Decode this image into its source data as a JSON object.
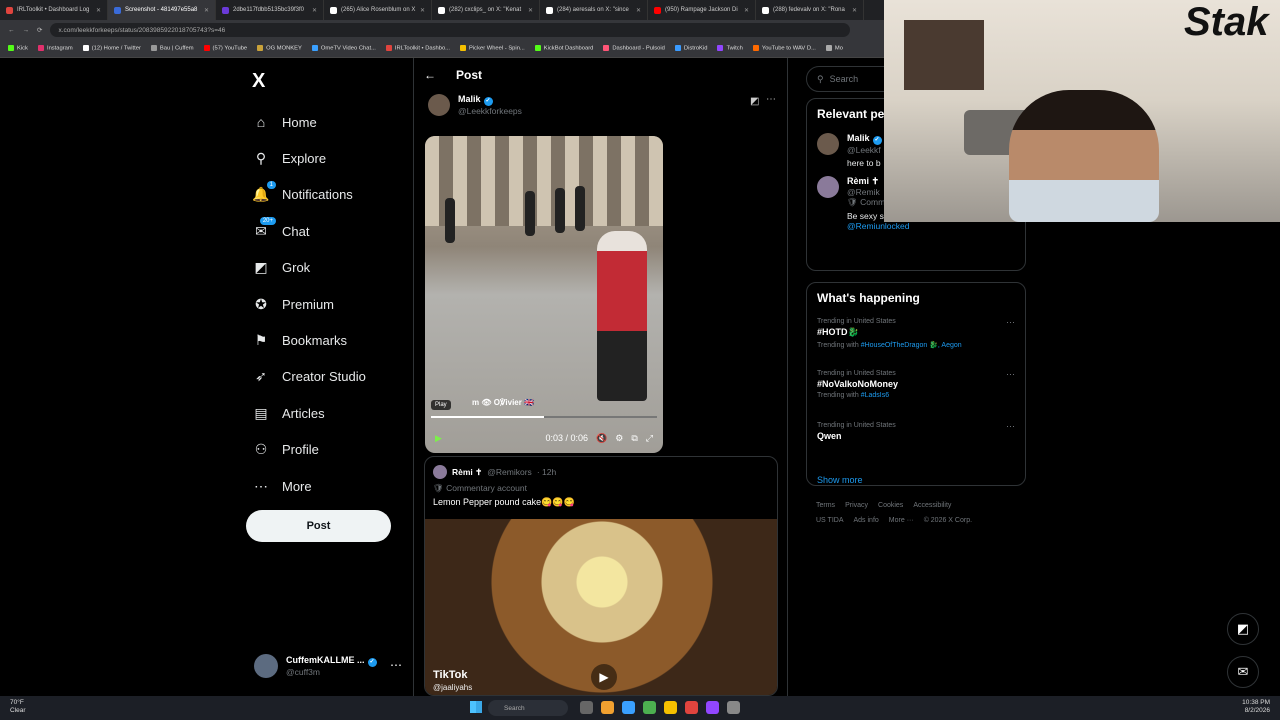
{
  "browser": {
    "tabs": [
      {
        "label": "IRLToolkit • Dashboard Log",
        "color": "#e0443e",
        "active": false
      },
      {
        "label": "Screenshot - 481497e55a8",
        "color": "#3a6bd9",
        "active": true
      },
      {
        "label": "2dbe117fdbb5135bc39f3f0",
        "color": "#6a3ad9",
        "active": false
      },
      {
        "label": "(265) Alice Rosenblum on X",
        "color": "#ffffff",
        "active": false
      },
      {
        "label": "(282) cxclips_ on X: \"Kenat",
        "color": "#ffffff",
        "active": false
      },
      {
        "label": "(284) aeresals on X: \"since",
        "color": "#ffffff",
        "active": false
      },
      {
        "label": "(950) Rampage Jackson Di",
        "color": "#ff0000",
        "active": false
      },
      {
        "label": "(288) fedevalv on X: \"Rona",
        "color": "#ffffff",
        "active": false
      }
    ],
    "url": "x.com/leekkforkeeps/status/2083985922018705743?s=46",
    "bookmarks": [
      {
        "label": "Kick",
        "color": "#53fc18"
      },
      {
        "label": "Instagram",
        "color": "#e1306c"
      },
      {
        "label": "(12) Home / Twitter",
        "color": "#ffffff"
      },
      {
        "label": "Bau | Cuffem",
        "color": "#999999"
      },
      {
        "label": "(57) YouTube",
        "color": "#ff0000"
      },
      {
        "label": "OG MONKEY",
        "color": "#c9a23a"
      },
      {
        "label": "OmeTV Video Chat...",
        "color": "#3aa0ff"
      },
      {
        "label": "IRLToolkit • Dashbo...",
        "color": "#e0443e"
      },
      {
        "label": "Picker Wheel - Spin...",
        "color": "#f5c000"
      },
      {
        "label": "KickBot Dashboard",
        "color": "#53fc18"
      },
      {
        "label": "Dashboard - Pulsoid",
        "color": "#ff5577"
      },
      {
        "label": "DistroKid",
        "color": "#3a9bff"
      },
      {
        "label": "Twitch",
        "color": "#9146ff"
      },
      {
        "label": "YouTube to WAV D...",
        "color": "#ff6a00"
      },
      {
        "label": "Mo",
        "color": "#aaaaaa"
      }
    ]
  },
  "nav": {
    "logo": "X",
    "items": [
      {
        "label": "Home",
        "icon": "home-icon",
        "glyph": "⌂"
      },
      {
        "label": "Explore",
        "icon": "search-icon",
        "glyph": "⚲"
      },
      {
        "label": "Notifications",
        "icon": "bell-icon",
        "glyph": "🔔",
        "badge": "1"
      },
      {
        "label": "Chat",
        "icon": "chat-icon",
        "glyph": "✉",
        "badge": "20+"
      },
      {
        "label": "Grok",
        "icon": "grok-icon",
        "glyph": "◩"
      },
      {
        "label": "Premium",
        "icon": "premium-icon",
        "glyph": "✪"
      },
      {
        "label": "Bookmarks",
        "icon": "bookmark-icon",
        "glyph": "⚑"
      },
      {
        "label": "Creator Studio",
        "icon": "rocket-icon",
        "glyph": "➶"
      },
      {
        "label": "Articles",
        "icon": "article-icon",
        "glyph": "▤"
      },
      {
        "label": "Profile",
        "icon": "person-icon",
        "glyph": "⚇"
      },
      {
        "label": "More",
        "icon": "more-icon",
        "glyph": "⋯"
      }
    ],
    "post_label": "Post",
    "account": {
      "name": "CuffemKALLME ...",
      "handle": "@cuff3m"
    }
  },
  "post": {
    "header": "Post",
    "author": {
      "name": "Malik",
      "handle": "@Leekkforkeeps"
    },
    "video": {
      "play_label": "Play",
      "watermark": "m 👁 O℣ivier 🇬🇧",
      "time": "0:03 / 0:06",
      "progress": 0.5
    },
    "reply": {
      "name": "Rèmi ✝",
      "handle": "@Remikors",
      "time": "· 12h",
      "sub": "Commentary account",
      "text": "Lemon Pepper pound cake😋😋😋",
      "tiktok": "TikTok",
      "tiktok_user": "@jaaliyahs"
    }
  },
  "right": {
    "search_placeholder": "Search",
    "relevant": {
      "title": "Relevant pe",
      "people": [
        {
          "name": "Malik",
          "handle": "@Leekkf",
          "bio": "here to b"
        },
        {
          "name": "Rèmi ✝",
          "handle": "@Remik",
          "sub": "Commentary account",
          "bio": "Be sexy so they can't ignore you",
          "link": "@Remiunlocked"
        }
      ]
    },
    "happening": {
      "title": "What's happening",
      "trends": [
        {
          "context": "Trending in United States",
          "tag": "#HOTD🐉",
          "with_prefix": "Trending with",
          "with": "#HouseOfTheDragon 🐉, Aegon"
        },
        {
          "context": "Trending in United States",
          "tag": "#NoValkoNoMoney",
          "with_prefix": "Trending with",
          "with": "#LadsIs6"
        },
        {
          "context": "Trending in United States",
          "tag": "Qwen",
          "with_prefix": "",
          "with": ""
        }
      ],
      "show_more": "Show more"
    },
    "footer": [
      "Terms",
      "Privacy",
      "Cookies",
      "Accessibility",
      "US TIDA",
      "Ads info",
      "More ···",
      "© 2026 X Corp."
    ]
  },
  "taskbar": {
    "weather_temp": "70°F",
    "weather_cond": "Clear",
    "search": "Search",
    "time": "10:38 PM",
    "date": "8/2/2026"
  }
}
